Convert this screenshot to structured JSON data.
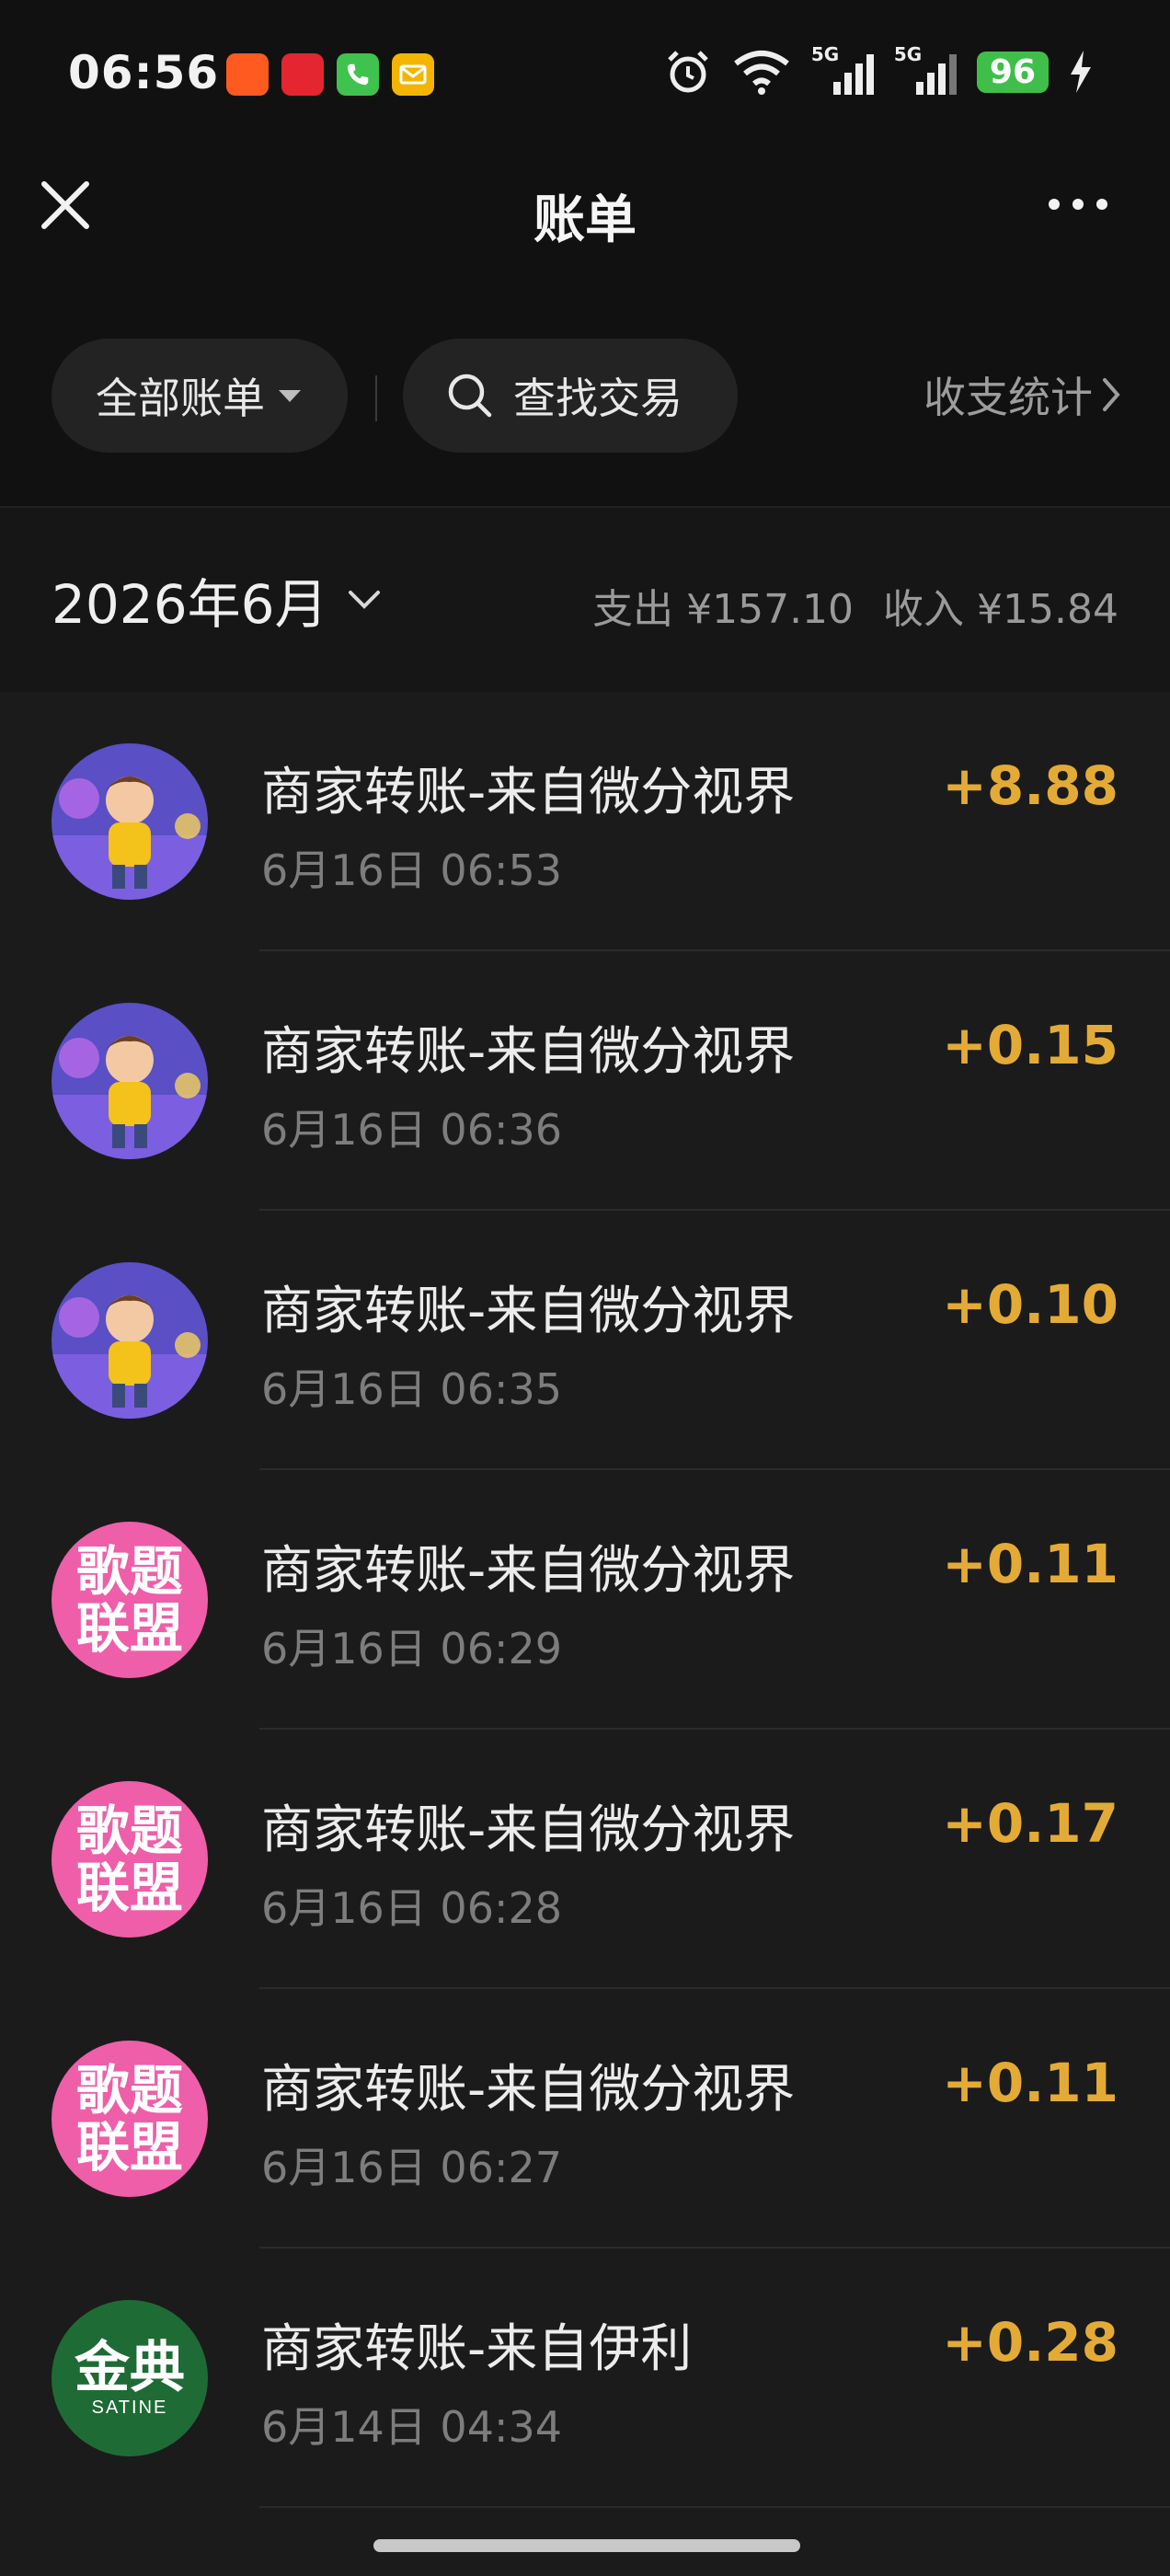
{
  "status": {
    "time": "06:56",
    "app_icons": [
      "taobao-icon",
      "xiaohongshu-icon",
      "phone-icon",
      "mail-icon"
    ],
    "signal_labels": [
      "5G",
      "5G"
    ],
    "battery": "96"
  },
  "header": {
    "title": "账单"
  },
  "filters": {
    "all_bills": "全部账单",
    "search": "查找交易",
    "stats": "收支统计"
  },
  "month": {
    "label": "2026年6月",
    "expense": "支出 ¥157.10",
    "income": "收入 ¥15.84"
  },
  "transactions": [
    {
      "title": "商家转账-来自微分视界",
      "time": "6月16日 06:53",
      "amount": "+8.88"
    },
    {
      "title": "商家转账-来自微分视界",
      "time": "6月16日 06:36",
      "amount": "+0.15"
    },
    {
      "title": "商家转账-来自微分视界",
      "time": "6月16日 06:35",
      "amount": "+0.10"
    },
    {
      "title": "商家转账-来自微分视界",
      "time": "6月16日 06:29",
      "amount": "+0.11"
    },
    {
      "title": "商家转账-来自微分视界",
      "time": "6月16日 06:28",
      "amount": "+0.17"
    },
    {
      "title": "商家转账-来自微分视界",
      "time": "6月16日 06:27",
      "amount": "+0.11"
    },
    {
      "title": "商家转账-来自伊利",
      "time": "6月14日 04:34",
      "amount": "+0.28"
    }
  ],
  "avatars": {
    "gtlm_line1": "歌题",
    "gtlm_line2": "联盟",
    "jindian": "金典",
    "jindian_sub": "SATINE"
  },
  "colors": {
    "accent_amount": "#e3ab35",
    "background": "#1b1b1b",
    "gtlm_pink": "#ef5ea8",
    "jindian_green": "#1f6b35"
  }
}
